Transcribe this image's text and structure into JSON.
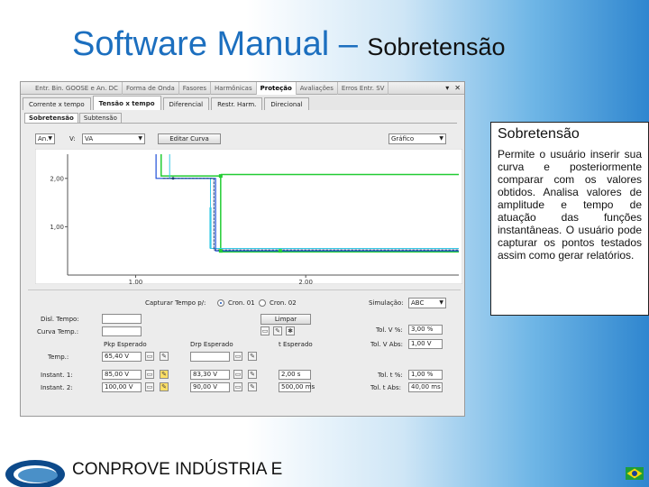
{
  "slide": {
    "title_main": "Software Manual – ",
    "title_sub": "Sobretensão",
    "footer_text": "CONPROVE INDÚSTRIA E"
  },
  "window": {
    "main_tabs": [
      {
        "label": "Entr. Bin. GOOSE e An. DC"
      },
      {
        "label": "Forma de Onda"
      },
      {
        "label": "Fasores"
      },
      {
        "label": "Harmônicas"
      },
      {
        "label": "Proteção",
        "active": true
      },
      {
        "label": "Avaliações"
      },
      {
        "label": "Erros Entr. SV"
      }
    ],
    "controls": {
      "menu": "▾",
      "close": "✕"
    },
    "protection_tabs": [
      {
        "label": "Corrente x tempo"
      },
      {
        "label": "Tensão x tempo",
        "active": true
      },
      {
        "label": "Diferencial"
      },
      {
        "label": "Restr. Harm."
      },
      {
        "label": "Direcional"
      }
    ],
    "sub_tabs": [
      {
        "label": "Sobretensão",
        "active": true
      },
      {
        "label": "Subtensão"
      }
    ]
  },
  "toolbar": {
    "select_a": "An.",
    "v_label": "V:",
    "select_v": "VA",
    "edit_curve_button": "Editar Curva",
    "graph_select": "Gráfico"
  },
  "chart_data": {
    "type": "line",
    "y_ticks": [
      "2,00",
      "1,00"
    ],
    "x_ticks": [
      "1,00",
      "2,00"
    ],
    "xlim": [
      0.6,
      2.9
    ],
    "ylim": [
      0.0,
      2.5
    ],
    "colors": {
      "green": "#22cc33",
      "blue": "#1f4fd8",
      "cyan": "#37c9e6",
      "dark": "#1d3f73"
    }
  },
  "capture": {
    "label": "Capturar Tempo p/:",
    "cron1": "Cron. 01",
    "cron2": "Cron. 02",
    "simulation_label": "Simulação:",
    "simulation_value": "ABC",
    "disp_label": "Disl. Tempo:",
    "curve_label": "Curva Temp.:",
    "clear_button": "Limpar"
  },
  "table": {
    "col_pick": "Pkp Esperado",
    "col_drop": "Drp Esperado",
    "col_time": "t Esperado",
    "rows": [
      {
        "label": "Temp.:",
        "pick": "65,40 V",
        "drop": "",
        "time": ""
      },
      {
        "label": "Instant. 1:",
        "pick": "85,00 V",
        "drop": "83,30 V",
        "time": "2,00 s"
      },
      {
        "label": "Instant. 2:",
        "pick": "100,00 V",
        "drop": "90,00 V",
        "time": "500,00 ms"
      }
    ],
    "tol": [
      {
        "label": "Tol. V %:",
        "value": "3,00 %"
      },
      {
        "label": "Tol. V Abs:",
        "value": "1,00 V"
      },
      {
        "label": "Tol. t %:",
        "value": "1,00 %"
      },
      {
        "label": "Tol. t Abs:",
        "value": "40,00 ms"
      }
    ]
  },
  "info_box": {
    "title": "Sobretensão",
    "body": "Permite o usuário inserir sua curva e posteriormente comparar com os valores obtidos. Analisa valores de amplitude e tempo de atuação das funções instantâneas. O usuário pode capturar os pontos testados assim como gerar relatórios."
  }
}
